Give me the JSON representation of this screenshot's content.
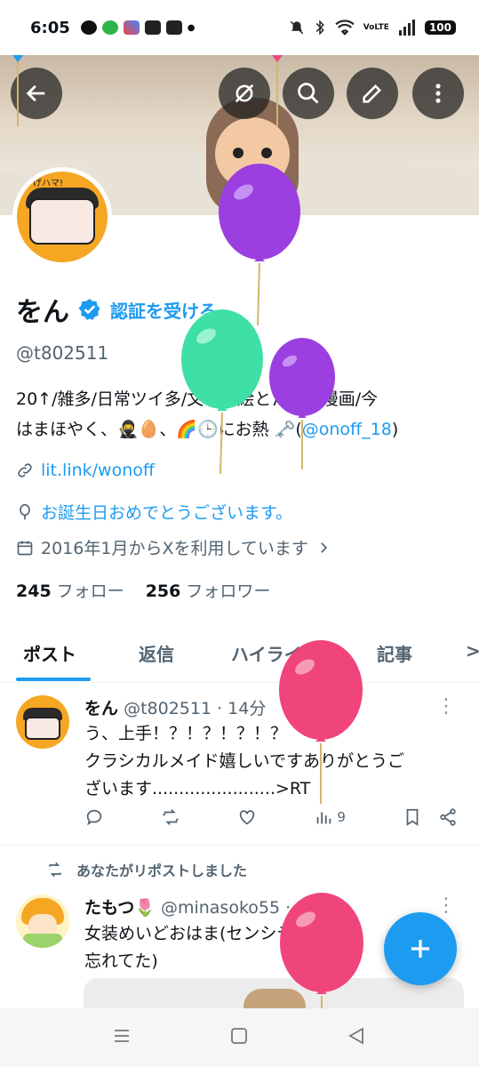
{
  "status_bar": {
    "time": "6:05",
    "battery": "100",
    "network": "VoLTE"
  },
  "header": {
    "back_label": "back",
    "buttons": [
      "no-signal-icon",
      "search-icon",
      "edit-icon",
      "more-vert-icon"
    ]
  },
  "profile": {
    "display_name": "をん",
    "get_verified": "認証を受ける",
    "handle": "@t802511",
    "bio_1": "20↑/雑多/日常ツイ多/文字と絵とたまに漫画/今",
    "bio_2": "はまほやく、🥷🥚、🌈🕒にお熱 🗝️(",
    "bio_mention": "@onoff_18",
    "bio_close": ")",
    "link": "lit.link/wonoff",
    "birthday": "お誕生日おめでとうございます。",
    "joined": "2016年1月からXを利用しています",
    "following_count": "245",
    "following_label": "フォロー",
    "followers_count": "256",
    "followers_label": "フォロワー",
    "avatar_text": "げハマ!"
  },
  "tabs": [
    {
      "label": "ポスト",
      "active": true
    },
    {
      "label": "返信"
    },
    {
      "label": "ハイライト"
    },
    {
      "label": "記事"
    },
    {
      "label": ">"
    }
  ],
  "tweets": [
    {
      "name": "をん",
      "handle_time": "@t802511 · 14分",
      "line1": "う、上手！？！？！？！？",
      "line2": "クラシカルメイド嬉しいですありがとうご",
      "line3": "ざいます.......................>RT",
      "views": "9"
    },
    {
      "repost_note": "あなたがリポストしました",
      "name": "たもつ🌷",
      "handle_time": "@minasoko55 · 5時間",
      "line1": "女装めいどおはま(センシティブに",
      "line2": "忘れてた)"
    }
  ],
  "colors": {
    "accent": "#1d9bf0",
    "balloon_purple": "#9b3fe0",
    "balloon_mint": "#3fe0a5",
    "balloon_pink": "#f0457a"
  }
}
